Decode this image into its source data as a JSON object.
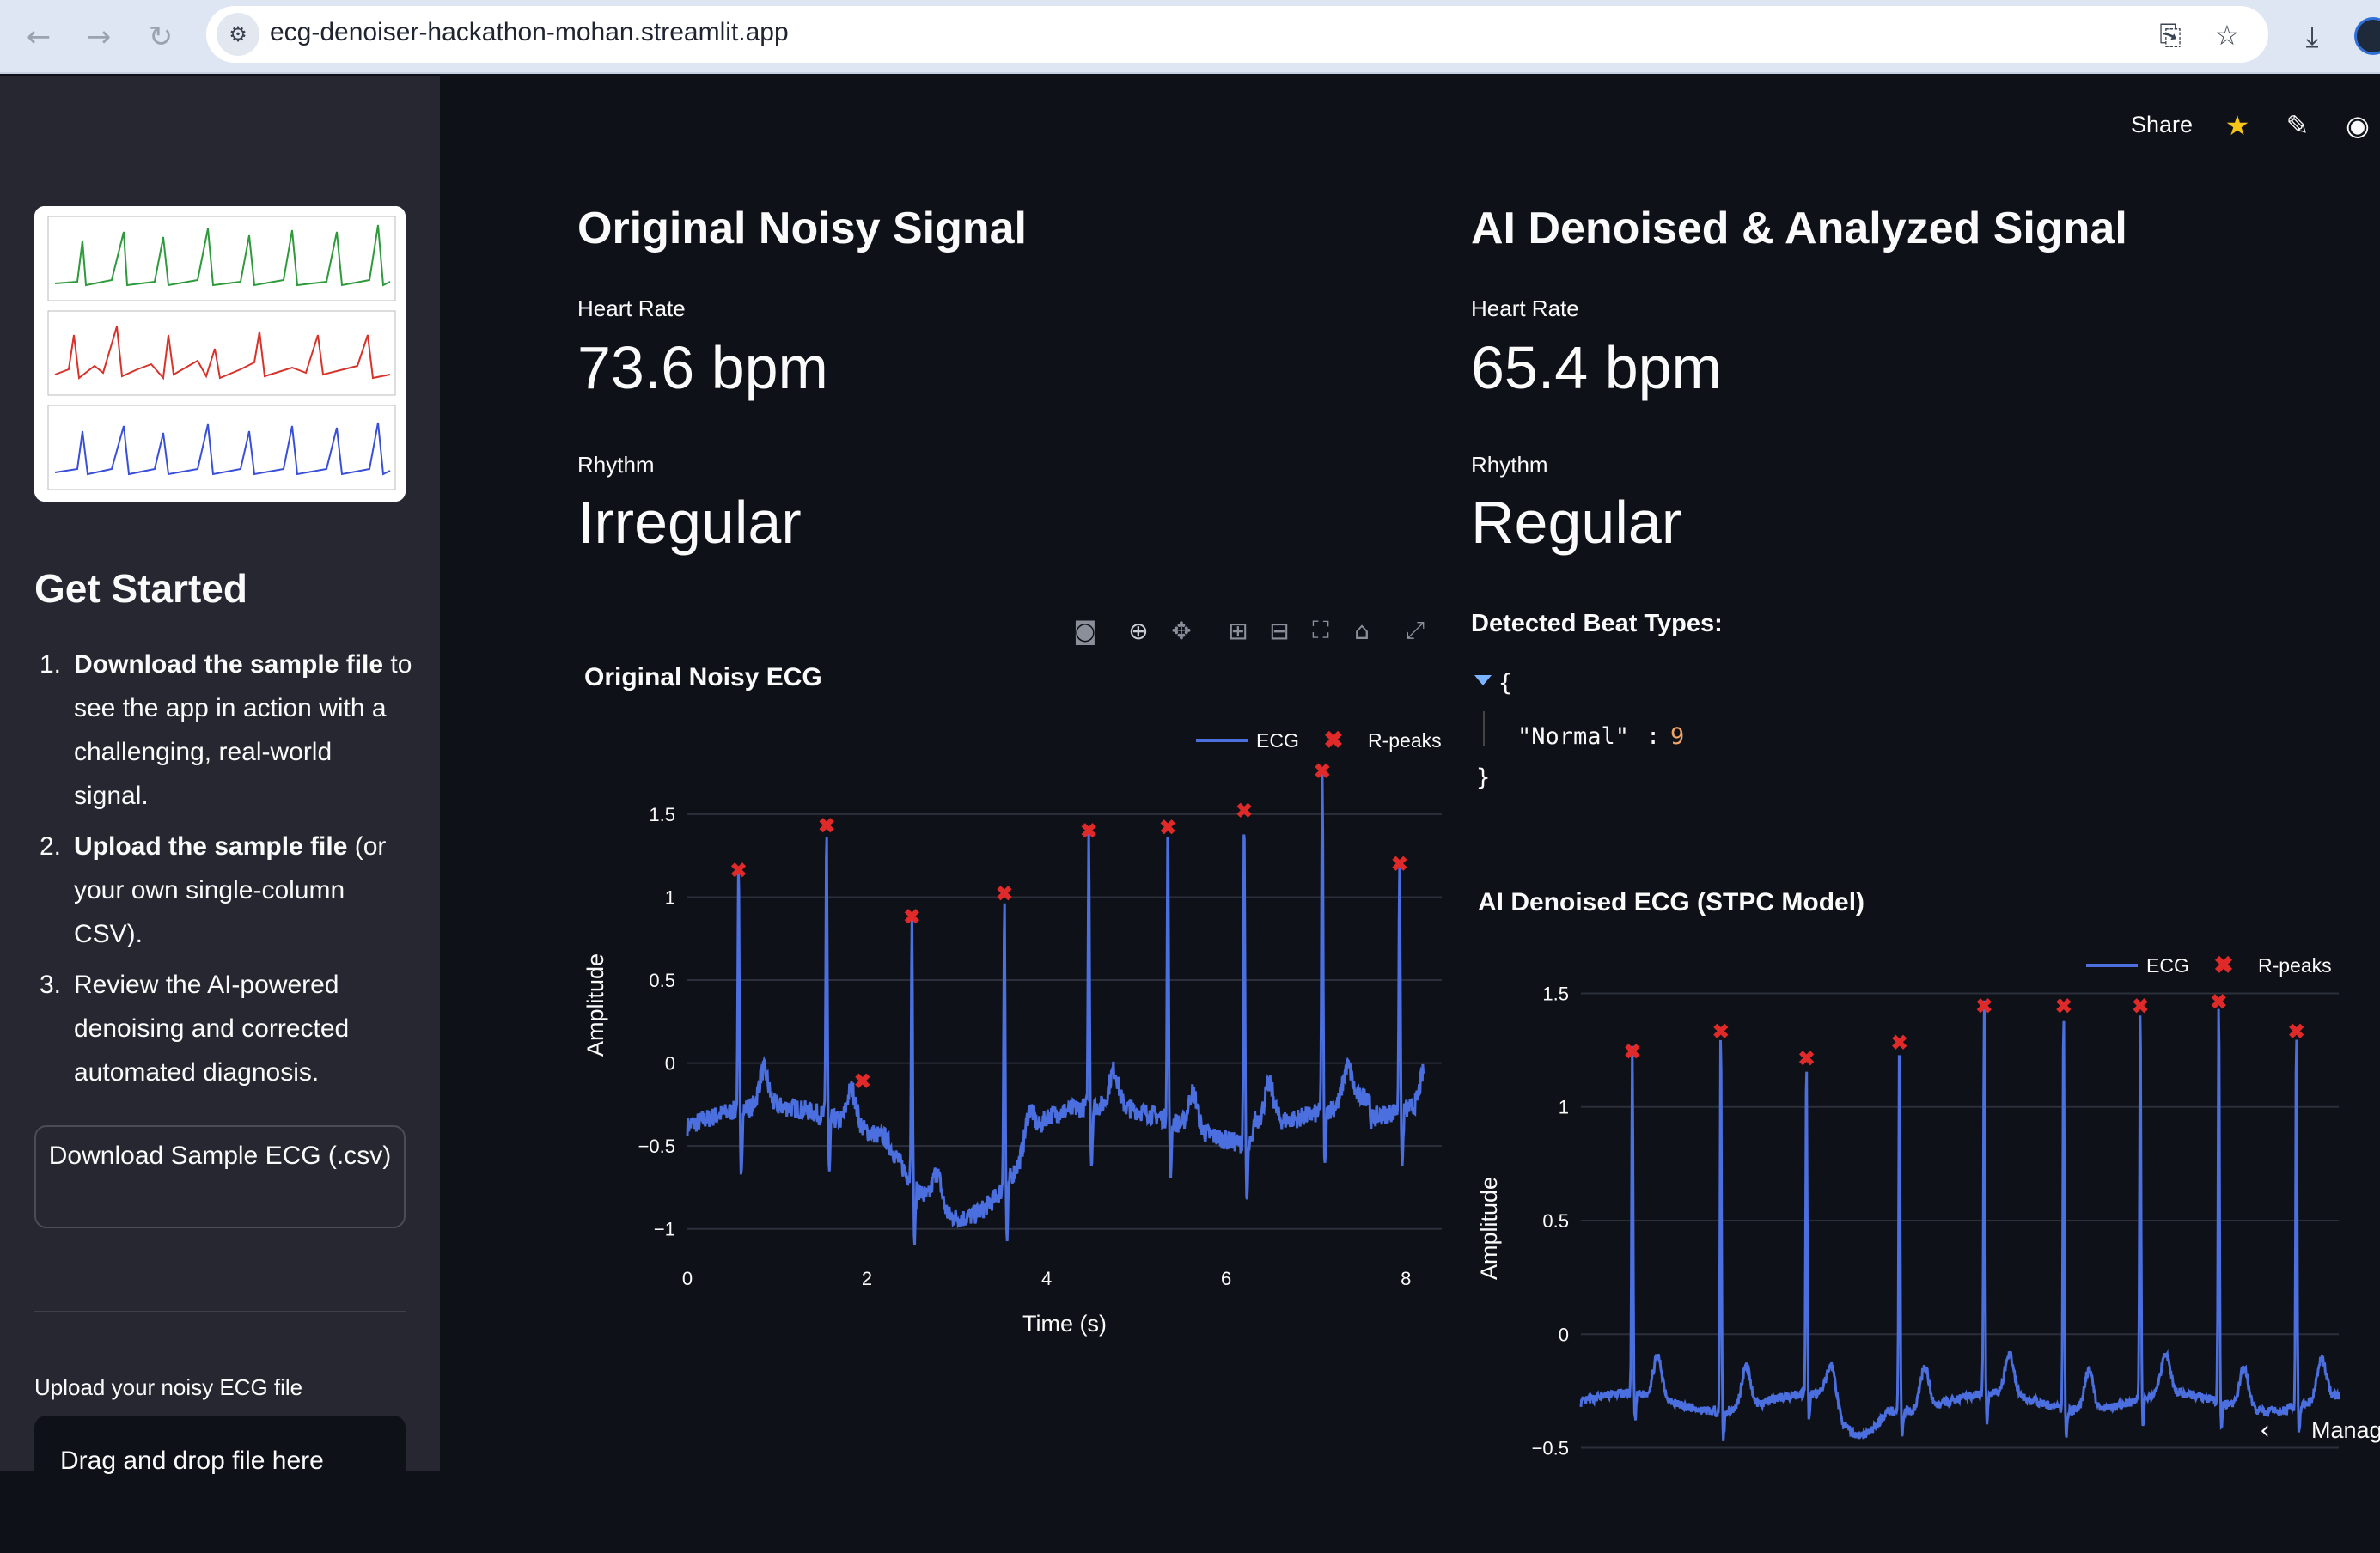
{
  "browser": {
    "url": "ecg-denoiser-hackathon-mohan.streamlit.app"
  },
  "sidebar": {
    "get_started_title": "Get Started",
    "steps": [
      {
        "num": "1.",
        "bold": "Download the sample file",
        "rest": " to see the app in action with a challenging, real-world signal."
      },
      {
        "num": "2.",
        "bold": "Upload the sample file",
        "rest": " (or your own single-column CSV)."
      },
      {
        "num": "3.",
        "bold": "",
        "rest": "Review the AI-powered denoising and corrected automated diagnosis."
      }
    ],
    "download_button": "Download Sample ECG (.csv)",
    "upload_label": "Upload your noisy ECG file",
    "dropzone_text": "Drag and drop file here"
  },
  "header": {
    "share_label": "Share"
  },
  "left_column": {
    "title": "Original Noisy Signal",
    "heart_rate_label": "Heart Rate",
    "heart_rate_value": "73.6 bpm",
    "rhythm_label": "Rhythm",
    "rhythm_value": "Irregular",
    "chart_title": "Original Noisy ECG"
  },
  "right_column": {
    "title": "AI Denoised & Analyzed Signal",
    "heart_rate_label": "Heart Rate",
    "heart_rate_value": "65.4 bpm",
    "rhythm_label": "Rhythm",
    "rhythm_value": "Regular",
    "beat_types_label": "Detected Beat Types:",
    "beat_json_open": "{",
    "beat_json_key": "\"Normal\"",
    "beat_json_colon": ":",
    "beat_json_value": "9",
    "beat_json_close": "}",
    "chart_title": "AI Denoised ECG (STPC Model)"
  },
  "manage_label": "Manag",
  "colors": {
    "ecg_line": "#4c6fe0",
    "r_peak": "#e02a2a",
    "background": "#0e1117",
    "sidebar": "#262730"
  },
  "chart_data": [
    {
      "type": "line",
      "title": "Original Noisy ECG",
      "xlabel": "Time (s)",
      "ylabel": "Amplitude",
      "xlim": [
        0,
        8.4
      ],
      "ylim": [
        -1.1,
        1.8
      ],
      "x_ticks": [
        0,
        2,
        4,
        6,
        8
      ],
      "y_ticks": [
        -1,
        -0.5,
        0,
        0.5,
        1,
        1.5
      ],
      "y_tick_labels": [
        "−1",
        "−0.5",
        "0",
        "0.5",
        "1",
        "1.5"
      ],
      "x_tick_labels": [
        "0",
        "2",
        "4",
        "6",
        "8"
      ],
      "legend": [
        "ECG",
        "R-peaks"
      ],
      "legend_position": "top-right",
      "grid": true,
      "r_peaks": {
        "x": [
          0.57,
          1.55,
          2.5,
          3.53,
          4.47,
          5.35,
          6.2,
          7.07,
          7.93
        ],
        "y": [
          1.17,
          1.44,
          0.89,
          1.03,
          1.41,
          1.43,
          1.53,
          1.77,
          1.21
        ]
      },
      "extra_peak": {
        "x": 1.95,
        "y": -0.1
      }
    },
    {
      "type": "line",
      "title": "AI Denoised ECG (STPC Model)",
      "xlabel": "",
      "ylabel": "Amplitude",
      "xlim": [
        0,
        8.4
      ],
      "ylim": [
        -0.6,
        1.6
      ],
      "y_ticks": [
        -0.5,
        0,
        0.5,
        1,
        1.5
      ],
      "y_tick_labels": [
        "−0.5",
        "0",
        "0.5",
        "1",
        "1.5"
      ],
      "legend": [
        "ECG",
        "R-peaks"
      ],
      "legend_position": "top-right",
      "grid": true,
      "r_peaks": {
        "x": [
          0.57,
          1.55,
          2.5,
          3.53,
          4.47,
          5.35,
          6.2,
          7.07,
          7.93
        ],
        "y": [
          1.25,
          1.34,
          1.22,
          1.29,
          1.45,
          1.45,
          1.45,
          1.47,
          1.34
        ]
      }
    }
  ]
}
